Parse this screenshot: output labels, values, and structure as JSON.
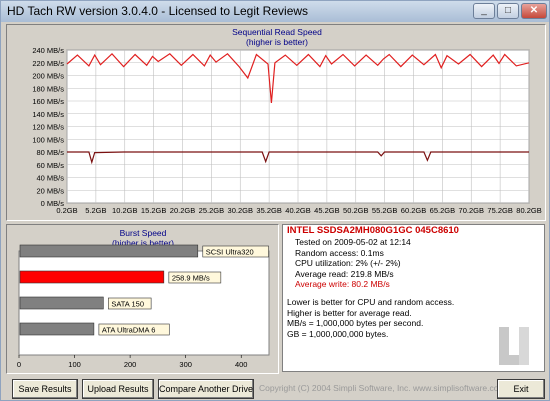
{
  "window": {
    "title": "HD Tach RW version 3.0.4.0  -  Licensed to Legit Reviews"
  },
  "read_chart": {
    "title": "Sequential Read Speed",
    "subtitle": "(higher is better)",
    "y_ticks": [
      "240 MB/s",
      "220 MB/s",
      "200 MB/s",
      "180 MB/s",
      "160 MB/s",
      "140 MB/s",
      "120 MB/s",
      "100 MB/s",
      "80 MB/s",
      "60 MB/s",
      "40 MB/s",
      "20 MB/s",
      "0 MB/s"
    ],
    "x_ticks": [
      "0.2GB",
      "5.2GB",
      "10.2GB",
      "15.2GB",
      "20.2GB",
      "25.2GB",
      "30.2GB",
      "35.2GB",
      "40.2GB",
      "45.2GB",
      "50.2GB",
      "55.2GB",
      "60.2GB",
      "65.2GB",
      "70.2GB",
      "75.2GB",
      "80.2GB"
    ]
  },
  "chart_data": [
    {
      "type": "line",
      "title": "Sequential Read Speed",
      "subtitle": "(higher is better)",
      "xlabel": "",
      "ylabel": "",
      "x_range_gb": [
        0.2,
        80.2
      ],
      "ylim": [
        0,
        240
      ],
      "grid": true,
      "series": [
        {
          "color": "#e02020",
          "x": [
            0.2,
            2,
            4,
            5,
            6,
            8,
            10,
            12,
            14,
            15,
            16,
            18,
            20,
            22,
            24,
            25,
            26,
            28,
            30,
            31.5,
            33,
            35,
            35.6,
            36.2,
            38,
            40,
            42,
            44,
            45,
            46,
            48,
            50,
            52,
            54,
            55,
            56,
            58,
            60,
            62,
            64,
            65,
            66,
            68,
            70,
            72,
            74,
            75,
            76,
            78,
            80.2
          ],
          "y": [
            218,
            232,
            215,
            232,
            217,
            234,
            214,
            233,
            216,
            230,
            222,
            234,
            216,
            233,
            215,
            232,
            221,
            234,
            214,
            196,
            233,
            218,
            157,
            220,
            232,
            216,
            233,
            214,
            231,
            218,
            233,
            215,
            232,
            216,
            226,
            233,
            214,
            232,
            217,
            233,
            212,
            231,
            218,
            233,
            214,
            232,
            219,
            233,
            215,
            220
          ]
        },
        {
          "color": "#7a1010",
          "x": [
            0.2,
            4,
            4.5,
            5,
            10,
            20,
            30,
            34,
            34.6,
            35.2,
            40,
            50,
            54,
            54.6,
            55.2,
            60,
            62,
            62.6,
            63.2,
            70,
            80.2
          ],
          "y": [
            80,
            80,
            64,
            79,
            80,
            80,
            80,
            80,
            65,
            80,
            80,
            80,
            80,
            74,
            80,
            80,
            80,
            67,
            80,
            80,
            80
          ]
        }
      ]
    },
    {
      "type": "bar",
      "title": "Burst Speed",
      "subtitle": "(higher is better)",
      "orientation": "horizontal",
      "xlim": [
        0,
        450
      ],
      "x_ticks": [
        "0",
        "100",
        "200",
        "300",
        "400"
      ],
      "categories": [
        "SCSI Ultra320",
        "258.9 MB/s",
        "SATA 150",
        "ATA UltraDMA 6"
      ],
      "values": [
        320,
        258.9,
        150,
        133
      ],
      "colors": [
        "#808080",
        "#ff0000",
        "#808080",
        "#808080"
      ]
    }
  ],
  "burst_chart": {
    "title": "Burst Speed",
    "subtitle": "(higher is better)",
    "x_ticks": [
      "0",
      "100",
      "200",
      "300",
      "400"
    ]
  },
  "info": {
    "drive": "INTEL SSDSA2MH080G1GC 045C8610",
    "tested": "Tested on 2009-05-02 at 12:14",
    "random_access": "Random access: 0.1ms",
    "cpu": "CPU utilization: 2% (+/- 2%)",
    "avg_read": "Average read: 219.8 MB/s",
    "avg_write": "Average write: 80.2 MB/s",
    "note1": "Lower is better for CPU and random access.",
    "note2": "Higher is better for average read.",
    "note3": "MB/s = 1,000,000 bytes per second.",
    "note4": "GB = 1,000,000,000 bytes."
  },
  "buttons": {
    "save": "Save Results",
    "upload": "Upload Results",
    "compare": "Compare Another Drive",
    "exit": "Exit"
  },
  "footer": {
    "copyright": "Copyright (C) 2004 Simpli Software, Inc. www.simplisoftware.com"
  },
  "colors": {
    "read_line": "#e02020",
    "write_line": "#7a1010",
    "highlight_bar": "#ff0000",
    "info_red": "#cc0000"
  }
}
